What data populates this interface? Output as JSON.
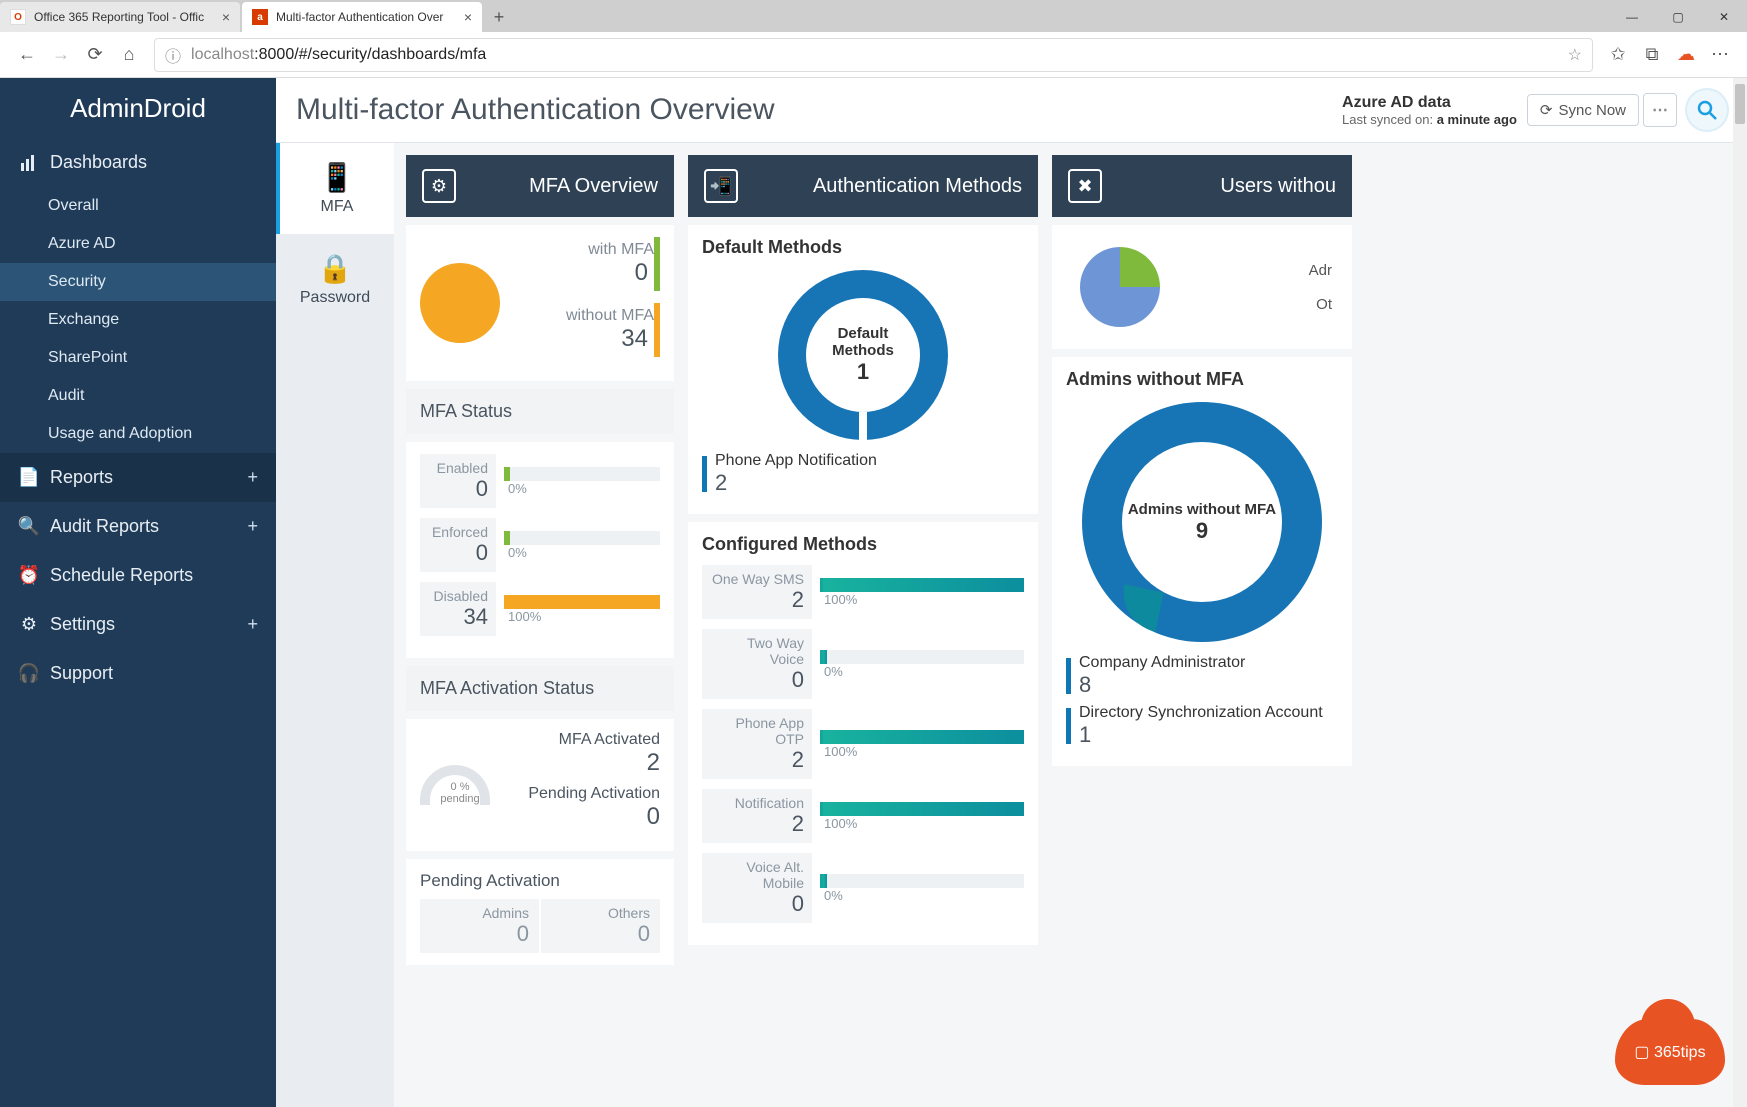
{
  "browser": {
    "tabs": [
      {
        "title": "Office 365 Reporting Tool - Offic",
        "favicon": "o365"
      },
      {
        "title": "Multi-factor Authentication Over",
        "favicon": "ad",
        "active": true
      }
    ],
    "url_host": "localhost",
    "url_path": ":8000/#/security/dashboards/mfa"
  },
  "brand": "AdminDroid",
  "sidebar": {
    "sections": [
      {
        "label": "Dashboards",
        "icon": "chart",
        "expandable": false,
        "items": [
          {
            "label": "Overall"
          },
          {
            "label": "Azure AD"
          },
          {
            "label": "Security",
            "active": true
          },
          {
            "label": "Exchange"
          },
          {
            "label": "SharePoint"
          },
          {
            "label": "Audit"
          },
          {
            "label": "Usage and Adoption"
          }
        ]
      },
      {
        "label": "Reports",
        "icon": "reports",
        "expandable": true
      },
      {
        "label": "Audit Reports",
        "icon": "audit",
        "expandable": true
      },
      {
        "label": "Schedule Reports",
        "icon": "clock",
        "expandable": false
      },
      {
        "label": "Settings",
        "icon": "gear",
        "expandable": true
      },
      {
        "label": "Support",
        "icon": "support",
        "expandable": false
      }
    ]
  },
  "header": {
    "title": "Multi-factor Authentication Overview",
    "data_source": "Azure AD data",
    "last_sync_prefix": "Last synced on: ",
    "last_sync_value": "a minute ago",
    "sync_button": "Sync Now"
  },
  "subnav": [
    {
      "label": "MFA",
      "active": true
    },
    {
      "label": "Password"
    }
  ],
  "mfa_overview": {
    "card_title": "MFA Overview",
    "with_mfa_label": "with MFA",
    "with_mfa_value": 0,
    "without_mfa_label": "without MFA",
    "without_mfa_value": 34,
    "status_title": "MFA Status",
    "status": [
      {
        "label": "Enabled",
        "value": 0,
        "pct": "0%",
        "color": "green",
        "fill": 2
      },
      {
        "label": "Enforced",
        "value": 0,
        "pct": "0%",
        "color": "green",
        "fill": 2
      },
      {
        "label": "Disabled",
        "value": 34,
        "pct": "100%",
        "color": "orange",
        "fill": 100
      }
    ],
    "activation_title": "MFA Activation Status",
    "gauge_text1": "0 %",
    "gauge_text2": "pending",
    "activated_label": "MFA Activated",
    "activated_value": 2,
    "pending_label": "Pending Activation",
    "pending_value": 0,
    "pending_table_title": "Pending Activation",
    "pending_cols": [
      {
        "label": "Admins",
        "value": 0
      },
      {
        "label": "Others",
        "value": 0
      }
    ]
  },
  "auth_methods": {
    "card_title": "Authentication Methods",
    "default_title": "Default Methods",
    "donut_label": "Default Methods",
    "donut_value": 1,
    "default_legend": [
      {
        "label": "Phone App Notification",
        "value": 2,
        "color": "#1077b7"
      }
    ],
    "configured_title": "Configured Methods",
    "configured": [
      {
        "label": "One Way SMS",
        "value": 2,
        "pct": "100%",
        "color": "teal",
        "fill": 100
      },
      {
        "label": "Two Way Voice",
        "value": 0,
        "pct": "0%",
        "color": "teal",
        "fill": 2
      },
      {
        "label": "Phone App OTP",
        "value": 2,
        "pct": "100%",
        "color": "teal",
        "fill": 100
      },
      {
        "label": "Notification",
        "value": 2,
        "pct": "100%",
        "color": "teal",
        "fill": 100
      },
      {
        "label": "Voice Alt. Mobile",
        "value": 0,
        "pct": "0%",
        "color": "teal",
        "fill": 2
      }
    ]
  },
  "users_without": {
    "card_title": "Users withou",
    "top_labels": [
      "Adr",
      "Ot"
    ],
    "section_title": "Admins without MFA",
    "donut_label": "Admins without MFA",
    "donut_value": 9,
    "legend": [
      {
        "label": "Company Administrator",
        "value": 8,
        "color": "#1077b7"
      },
      {
        "label": "Directory Synchronization Account",
        "value": 1,
        "color": "#1077b7"
      }
    ]
  },
  "badge": "365tips",
  "chart_data": [
    {
      "type": "pie",
      "title": "MFA Overview",
      "series": [
        {
          "name": "with MFA",
          "value": 0
        },
        {
          "name": "without MFA",
          "value": 34
        }
      ]
    },
    {
      "type": "bar",
      "title": "MFA Status",
      "categories": [
        "Enabled",
        "Enforced",
        "Disabled"
      ],
      "values": [
        0,
        0,
        34
      ],
      "ylim": [
        0,
        34
      ]
    },
    {
      "type": "pie",
      "title": "Default Methods",
      "series": [
        {
          "name": "Phone App Notification",
          "value": 1
        }
      ]
    },
    {
      "type": "bar",
      "title": "Configured Methods",
      "categories": [
        "One Way SMS",
        "Two Way Voice",
        "Phone App OTP",
        "Notification",
        "Voice Alt. Mobile"
      ],
      "values": [
        2,
        0,
        2,
        2,
        0
      ],
      "ylim": [
        0,
        2
      ]
    },
    {
      "type": "pie",
      "title": "Admins without MFA",
      "series": [
        {
          "name": "Company Administrator",
          "value": 8
        },
        {
          "name": "Directory Synchronization Account",
          "value": 1
        }
      ]
    }
  ]
}
